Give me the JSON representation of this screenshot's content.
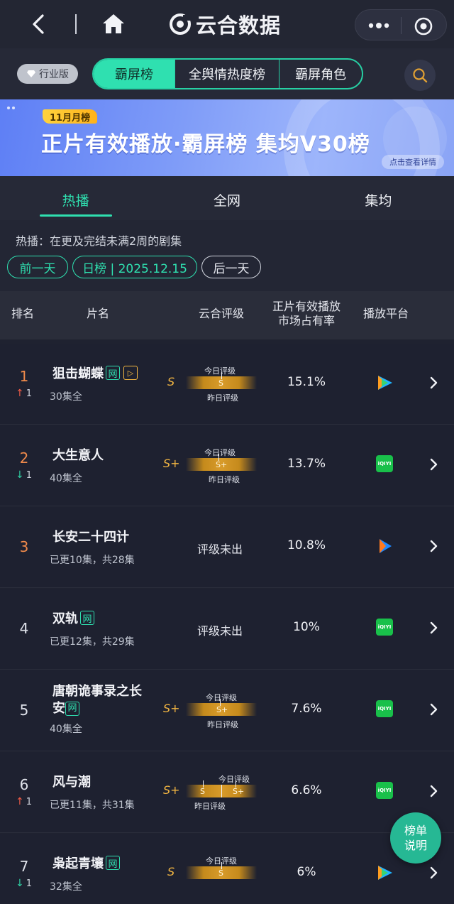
{
  "header": {
    "brand": "云合数据",
    "icons": [
      "back-icon",
      "home-icon",
      "more-icon",
      "target-icon"
    ]
  },
  "nav": {
    "industry_badge": "行业版",
    "segments": [
      "霸屏榜",
      "全舆情热度榜",
      "霸屏角色"
    ],
    "active_segment": 0,
    "accent_color": "#2fe0b0"
  },
  "banner": {
    "tag": "11月月榜",
    "title": "正片有效播放·霸屏榜 集均V30榜",
    "detail_button": "点击查看详情"
  },
  "tabs": {
    "items": [
      "热播",
      "全网",
      "集均"
    ],
    "active": 0
  },
  "info": {
    "note": "热播：在更及完结未满2周的剧集",
    "prev_day": "前一天",
    "date_label": "日榜 | 2025.12.15",
    "next_day": "后一天"
  },
  "table": {
    "headers": {
      "rank": "排名",
      "name": "片名",
      "rating": "云合评级",
      "share_line1": "正片有效播放",
      "share_line2": "市场占有率",
      "platform": "播放平台"
    },
    "today_label": "今日评级",
    "yesterday_label": "昨日评级",
    "unrated_label": "评级未出",
    "rows": [
      {
        "rank": "1",
        "change": "1",
        "direction": "up",
        "name": "狙击蝴蝶",
        "web_tag": "网",
        "play_tag": "▷",
        "episodes": "30集全",
        "grade": "S",
        "today_grade": "S",
        "yesterday_grade": "",
        "share": "15.1%",
        "platform": "tencent-video-icon"
      },
      {
        "rank": "2",
        "change": "1",
        "direction": "down",
        "name": "大生意人",
        "web_tag": "",
        "play_tag": "",
        "episodes": "40集全",
        "grade": "S+",
        "today_grade": "S+",
        "yesterday_grade": "",
        "share": "13.7%",
        "platform": "iqiyi-icon"
      },
      {
        "rank": "3",
        "change": "",
        "direction": "",
        "name": "长安二十四计",
        "web_tag": "",
        "play_tag": "",
        "episodes": "已更10集，共28集",
        "grade": "",
        "share": "10.8%",
        "platform": "youku-icon"
      },
      {
        "rank": "4",
        "change": "",
        "direction": "",
        "name": "双轨",
        "web_tag": "网",
        "play_tag": "",
        "episodes": "已更12集，共29集",
        "grade": "",
        "share": "10%",
        "platform": "iqiyi-icon"
      },
      {
        "rank": "5",
        "change": "",
        "direction": "",
        "name": "唐朝诡事录之长安",
        "web_tag": "网",
        "play_tag": "",
        "episodes": "40集全",
        "grade": "S+",
        "today_grade": "S+",
        "yesterday_grade": "",
        "share": "7.6%",
        "platform": "iqiyi-icon"
      },
      {
        "rank": "6",
        "change": "1",
        "direction": "up",
        "name": "风与潮",
        "web_tag": "",
        "play_tag": "",
        "episodes": "已更11集，共31集",
        "grade": "S+",
        "today_grade": "S+",
        "yesterday_grade": "S",
        "share": "6.6%",
        "platform": "iqiyi-icon"
      },
      {
        "rank": "7",
        "change": "1",
        "direction": "down",
        "name": "枭起青壤",
        "web_tag": "网",
        "play_tag": "",
        "episodes": "32集全",
        "grade": "S",
        "today_grade": "S",
        "yesterday_grade": "",
        "share": "6%",
        "platform": "tencent-video-icon"
      }
    ]
  },
  "help_button": {
    "line1": "榜单",
    "line2": "说明"
  }
}
